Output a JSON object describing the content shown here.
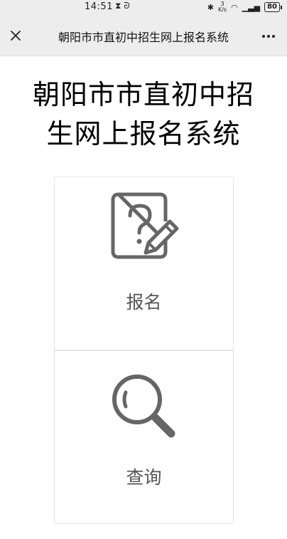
{
  "status_bar": {
    "time": "14:51",
    "left_icons": [
      "hourglass-icon",
      "ear-icon"
    ],
    "right_icons": [
      "bluetooth-icon",
      "network-speed-icon",
      "wifi-icon",
      "signal-icon"
    ],
    "net_speed": "3\nK/s",
    "battery": "80"
  },
  "navbar": {
    "title": "朝阳市市直初中招生网上报名系统",
    "close_icon": "close-icon",
    "more_icon": "more-icon"
  },
  "page": {
    "title_line1": "朝阳市市直初中招",
    "title_line2": "生网上报名系统"
  },
  "cards": {
    "register": {
      "label": "报名",
      "icon": "question-document-pencil-icon"
    },
    "query": {
      "label": "查询",
      "icon": "magnifier-icon"
    }
  },
  "colors": {
    "bar_bg": "#ededed",
    "icon_gray": "#666666",
    "label_gray": "#555555"
  }
}
